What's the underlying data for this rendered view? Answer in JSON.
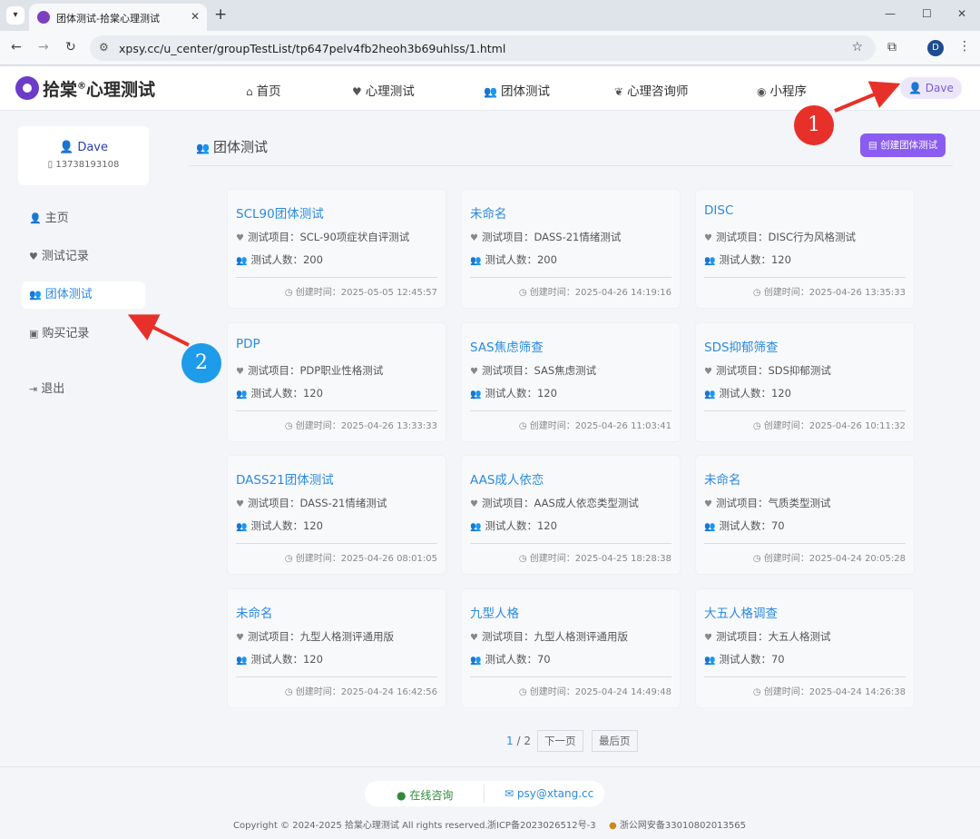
{
  "browser": {
    "tab_title": "团体测试-拾棠心理测试",
    "url": "xpsy.cc/u_center/groupTestList/tp647pelv4fb2heoh3b69uhlss/1.html",
    "profile_initial": "D"
  },
  "site": {
    "logo_text": "拾棠",
    "logo_reg": "®",
    "logo_tail": "心理测试"
  },
  "nav": {
    "items": [
      {
        "label": "首页",
        "icon": "home-icon"
      },
      {
        "label": "心理测试",
        "icon": "heartbeat-icon"
      },
      {
        "label": "团体测试",
        "icon": "group-icon"
      },
      {
        "label": "心理咨询师",
        "icon": "counselor-icon"
      },
      {
        "label": "小程序",
        "icon": "miniprogram-icon"
      }
    ],
    "user": "Dave"
  },
  "user_card": {
    "name": "Dave",
    "phone": "13738193108"
  },
  "sidebar": {
    "items": [
      {
        "label": "主页"
      },
      {
        "label": "测试记录"
      },
      {
        "label": "团体测试"
      },
      {
        "label": "购买记录"
      },
      {
        "label": "退出"
      }
    ],
    "active": "团体测试"
  },
  "section": {
    "title": "团体测试",
    "create_button": "创建团体测试"
  },
  "cards": [
    {
      "title": "SCL90团体测试",
      "project": "测试项目：SCL-90项症状自评测试",
      "count": "测试人数：200",
      "time": "创建时间：2025-05-05 12:45:57"
    },
    {
      "title": "未命名",
      "project": "测试项目：DASS-21情绪测试",
      "count": "测试人数：200",
      "time": "创建时间：2025-04-26 14:19:16"
    },
    {
      "title": "DISC",
      "project": "测试项目：DISC行为风格测试",
      "count": "测试人数：120",
      "time": "创建时间：2025-04-26 13:35:33"
    },
    {
      "title": "PDP",
      "project": "测试项目：PDP职业性格测试",
      "count": "测试人数：120",
      "time": "创建时间：2025-04-26 13:33:33"
    },
    {
      "title": "SAS焦虑筛查",
      "project": "测试项目：SAS焦虑测试",
      "count": "测试人数：120",
      "time": "创建时间：2025-04-26 11:03:41"
    },
    {
      "title": "SDS抑郁筛查",
      "project": "测试项目：SDS抑郁测试",
      "count": "测试人数：120",
      "time": "创建时间：2025-04-26 10:11:32"
    },
    {
      "title": "DASS21团体测试",
      "project": "测试项目：DASS-21情绪测试",
      "count": "测试人数：120",
      "time": "创建时间：2025-04-26 08:01:05"
    },
    {
      "title": "AAS成人依恋",
      "project": "测试项目：AAS成人依恋类型测试",
      "count": "测试人数：120",
      "time": "创建时间：2025-04-25 18:28:38"
    },
    {
      "title": "未命名",
      "project": "测试项目：气质类型测试",
      "count": "测试人数：70",
      "time": "创建时间：2025-04-24 20:05:28"
    },
    {
      "title": "未命名",
      "project": "测试项目：九型人格测评通用版",
      "count": "测试人数：120",
      "time": "创建时间：2025-04-24 16:42:56"
    },
    {
      "title": "九型人格",
      "project": "测试项目：九型人格测评通用版",
      "count": "测试人数：70",
      "time": "创建时间：2025-04-24 14:49:48"
    },
    {
      "title": "大五人格调查",
      "project": "测试项目：大五人格测试",
      "count": "测试人数：70",
      "time": "创建时间：2025-04-24 14:26:38"
    }
  ],
  "pager": {
    "current": "1",
    "total": "/ 2",
    "next": "下一页",
    "last": "最后页"
  },
  "footer": {
    "consult_online": "在线咨询",
    "email": "psy@xtang.cc",
    "copyright": "Copyright © 2024-2025 拾棠心理测试 All rights reserved.",
    "icp": "浙ICP备2023026512号-3",
    "police": "浙公网安备33010802013565"
  },
  "annotations": {
    "one": "1",
    "two": "2"
  },
  "colors": {
    "accent_blue": "#2b8ae0",
    "brand_purple": "#8a5cf0",
    "annotation_red": "#e8302a",
    "annotation_blue": "#1e9be9"
  }
}
